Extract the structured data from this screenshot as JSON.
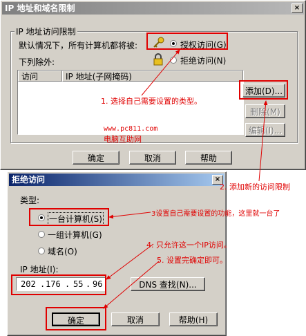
{
  "main_dialog": {
    "title": "IP 地址和域名限制",
    "close": "×",
    "group_title": "IP 地址访问限制",
    "default_text": "默认情况下，所有计算机都将被:",
    "grant_label": "授权访问(G)",
    "deny_label": "拒绝访问(N)",
    "except_label": "下列除外:",
    "col_access": "访问",
    "col_ip": "IP 地址(子网掩码)",
    "add_button": "添加(D)...",
    "remove_button": "删除(M)",
    "edit_button": "编辑(I)...",
    "ok_button": "确定",
    "cancel_button": "取消",
    "help_button": "帮助"
  },
  "deny_dialog": {
    "title": "拒绝访问",
    "close": "×",
    "type_label": "类型:",
    "single_label": "一台计算机(S)",
    "group_label": "一组计算机(G)",
    "domain_label": "域名(O)",
    "ip_label": "IP 地址(I):",
    "ip_segments": [
      "202",
      "176",
      "55",
      "96"
    ],
    "dns_button": "DNS 查找(N)...",
    "ok_button": "确定",
    "cancel_button": "取消",
    "help_button": "帮助(H)"
  },
  "watermark": {
    "url": "www.pc811.com",
    "name": "电脑互助网"
  },
  "annotations": {
    "note1": "1. 选择自己需要设置的类型。",
    "note2": "2. 添加新的访问限制",
    "note3": "3设置自己需要设置的功能，这里就一台了",
    "note4": "4. 只允许这一个IP访问。",
    "note5": "5. 设置完确定即可。"
  },
  "colors": {
    "highlight": "#e00000",
    "titlebar_active": "#0a246a",
    "dialog_bg": "#d4d0c8"
  }
}
